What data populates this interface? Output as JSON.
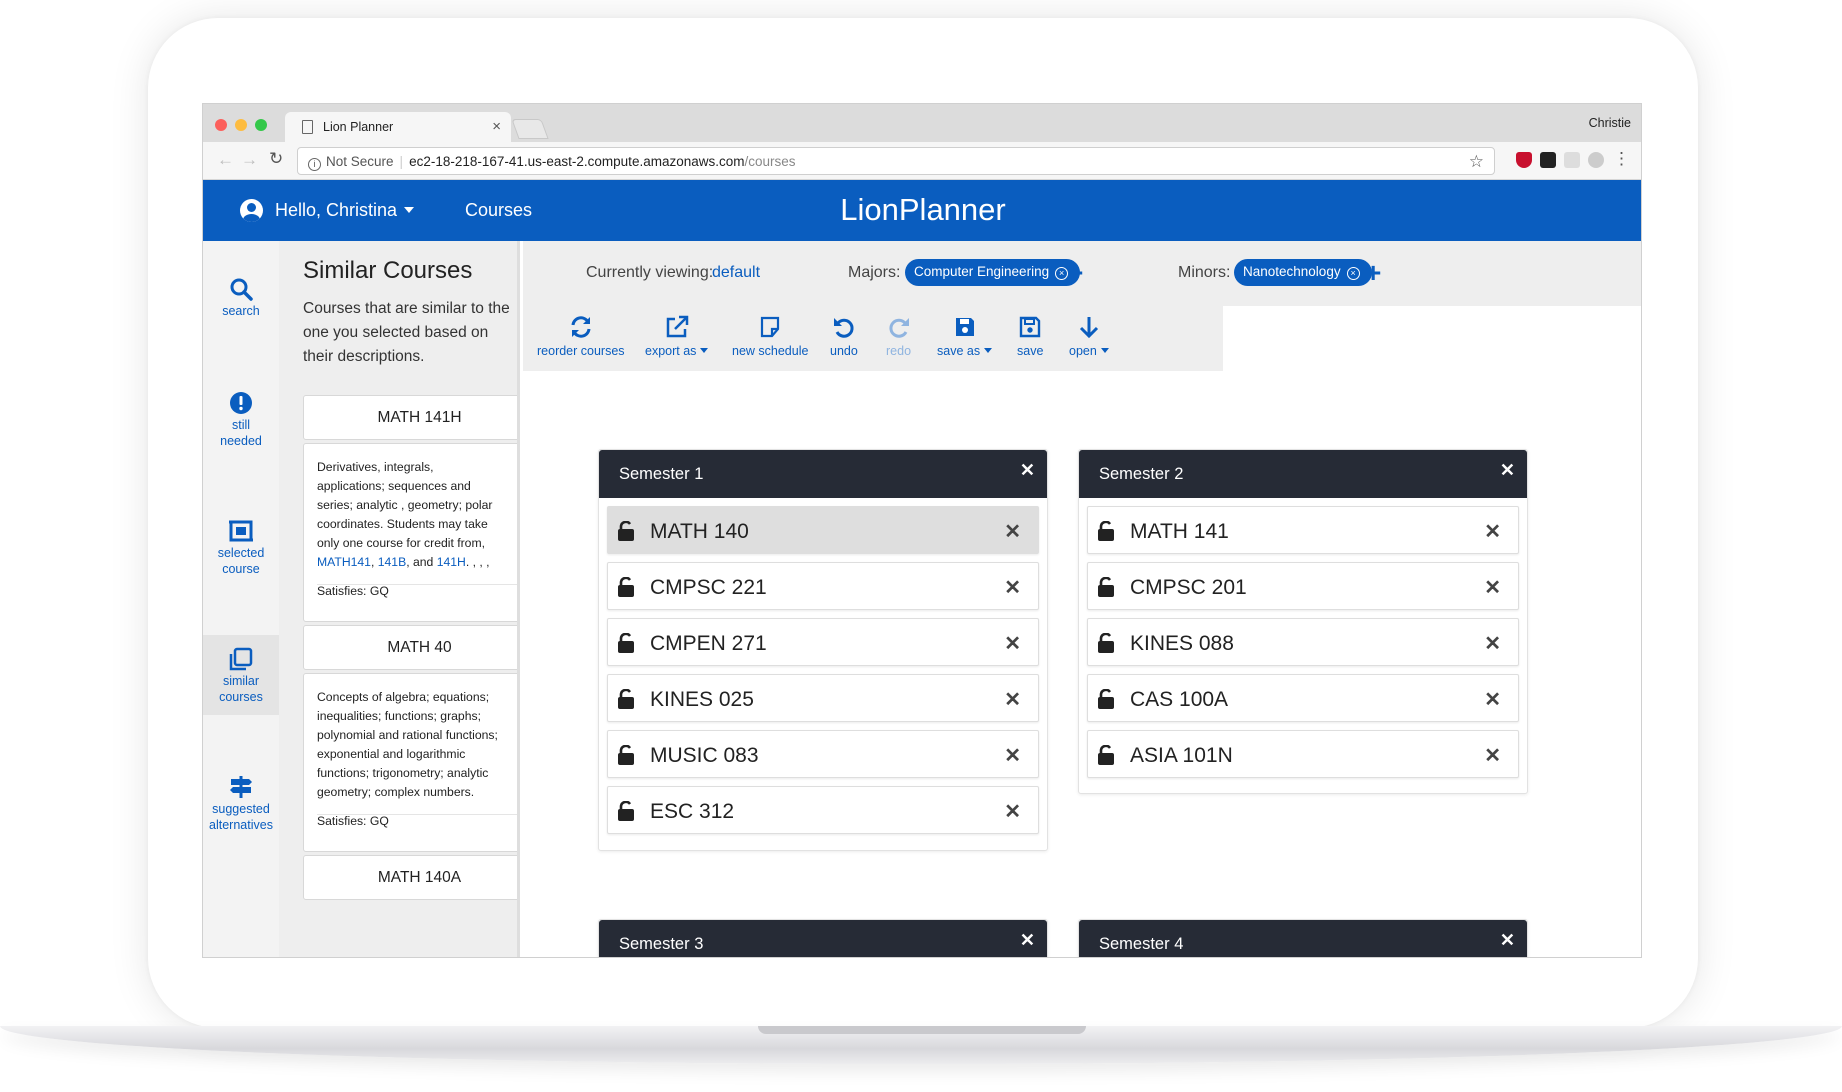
{
  "browser": {
    "tab_title": "Lion Planner",
    "profile": "Christie",
    "security": "Not Secure",
    "url_host": "ec2-18-218-167-41.us-east-2.compute.amazonaws.com",
    "url_path": "/courses"
  },
  "header": {
    "greeting": "Hello, Christina",
    "nav_courses": "Courses",
    "brand": "LionPlanner",
    "brand_color": "#0a5dbf"
  },
  "rail": [
    {
      "label": "search",
      "icon": "search-icon"
    },
    {
      "label_1": "still",
      "label_2": "needed",
      "icon": "exclamation-icon"
    },
    {
      "label_1": "selected",
      "label_2": "course",
      "icon": "selected-course-icon"
    },
    {
      "label_1": "similar",
      "label_2": "courses",
      "icon": "similar-courses-icon"
    },
    {
      "label_1": "suggested",
      "label_2": "alternatives",
      "icon": "signpost-icon"
    }
  ],
  "similar": {
    "title": "Similar Courses",
    "description": "Courses that are similar to the one you selected based on their descriptions.",
    "courses": [
      {
        "code": "MATH 141H",
        "desc_lines": [
          "Derivatives, integrals,",
          "applications; sequences and",
          "series; analytic , geometry; polar",
          "coordinates. Students may take",
          "only one course for credit from,"
        ],
        "links": [
          "MATH141",
          "141B",
          "141H"
        ],
        "link_sep_1": ", ",
        "link_sep_2": ", and ",
        "link_tail": ". , , ,",
        "satisfies_label": "Satisfies:",
        "satisfies": "GQ"
      },
      {
        "code": "MATH 40",
        "desc_lines": [
          "Concepts of algebra; equations;",
          "inequalities; functions; graphs;",
          "polynomial and rational functions;",
          "exponential and logarithmic",
          "functions; trigonometry; analytic",
          "geometry; complex numbers."
        ],
        "satisfies_label": "Satisfies:",
        "satisfies": "GQ"
      },
      {
        "code": "MATH 140A"
      }
    ]
  },
  "infobar": {
    "viewing_label": "Currently viewing:",
    "viewing_value": "default",
    "majors_label": "Majors:",
    "major": "Computer Engineering",
    "minors_label": "Minors:",
    "minor": "Nanotechnology"
  },
  "toolbar": [
    {
      "label": "reorder courses",
      "icon": "sync-icon"
    },
    {
      "label": "export as",
      "icon": "export-icon"
    },
    {
      "label": "new schedule",
      "icon": "new-note-icon"
    },
    {
      "label": "undo",
      "icon": "undo-icon"
    },
    {
      "label": "redo",
      "icon": "redo-icon",
      "disabled": true
    },
    {
      "label": "save as",
      "icon": "floppy-icon"
    },
    {
      "label": "save",
      "icon": "floppy-outline-icon"
    },
    {
      "label": "open",
      "icon": "arrow-down-icon"
    }
  ],
  "semesters": [
    {
      "title": "Semester 1",
      "courses": [
        "MATH 140",
        "CMPSC 221",
        "CMPEN 271",
        "KINES 025",
        "MUSIC 083",
        "ESC 312"
      ]
    },
    {
      "title": "Semester 2",
      "courses": [
        "MATH 141",
        "CMPSC 201",
        "KINES 088",
        "CAS 100A",
        "ASIA 101N"
      ]
    },
    {
      "title": "Semester 3",
      "courses": []
    },
    {
      "title": "Semester 4",
      "courses": []
    }
  ]
}
